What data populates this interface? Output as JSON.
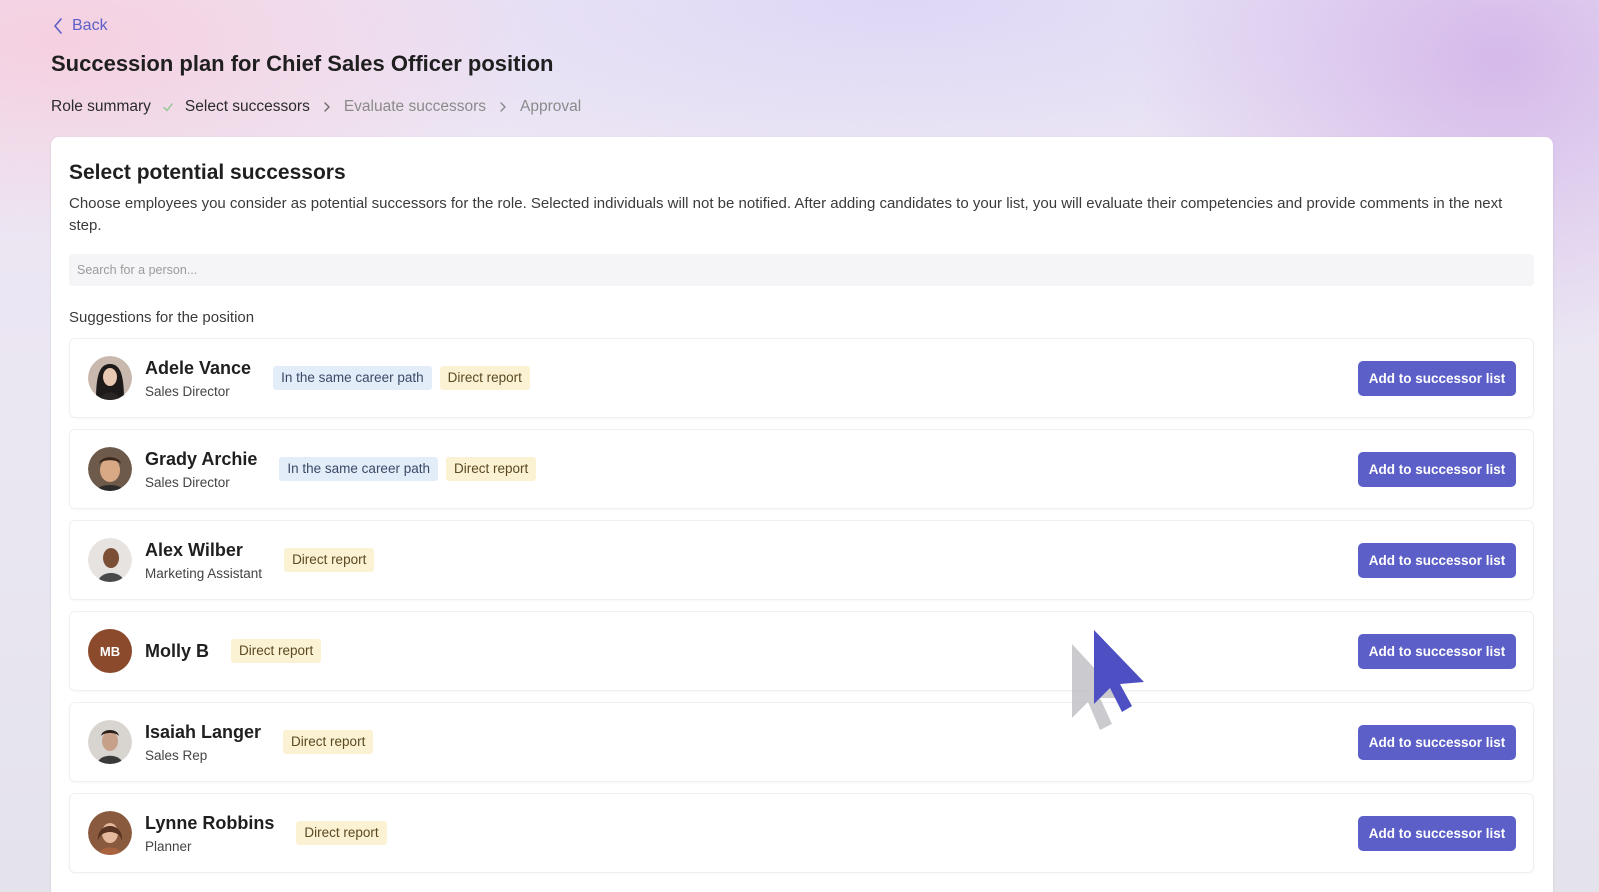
{
  "nav": {
    "back_label": "Back"
  },
  "page": {
    "title": "Succession plan for Chief Sales Officer position"
  },
  "steps": [
    {
      "label": "Role summary",
      "state": "done"
    },
    {
      "label": "Select successors",
      "state": "current"
    },
    {
      "label": "Evaluate successors",
      "state": "future"
    },
    {
      "label": "Approval",
      "state": "future"
    }
  ],
  "card": {
    "title": "Select potential successors",
    "description": "Choose employees you consider as potential successors for the role. Selected individuals will not be notified. After adding candidates to your list, you will evaluate their competencies and provide comments in the next step.",
    "search_placeholder": "Search for a person...",
    "section_label": "Suggestions for the position"
  },
  "people": [
    {
      "name": "Adele Vance",
      "role": "Sales Director",
      "tags": [
        "In the same career path",
        "Direct report"
      ],
      "button": "Add to successor list"
    },
    {
      "name": "Grady Archie",
      "role": "Sales Director",
      "tags": [
        "In the same career path",
        "Direct report"
      ],
      "button": "Add to successor list"
    },
    {
      "name": "Alex Wilber",
      "role": "Marketing Assistant",
      "tags": [
        "Direct report"
      ],
      "button": "Add to successor list"
    },
    {
      "name": "Molly B",
      "role": "",
      "initials": "MB",
      "tags": [
        "Direct report"
      ],
      "button": "Add to successor list"
    },
    {
      "name": "Isaiah Langer",
      "role": "Sales Rep",
      "tags": [
        "Direct report"
      ],
      "button": "Add to successor list"
    },
    {
      "name": "Lynne Robbins",
      "role": "Planner",
      "tags": [
        "Direct report"
      ],
      "button": "Add to successor list"
    }
  ],
  "colors": {
    "accent": "#5b5fc7",
    "tag_career_bg": "#e3ecf9",
    "tag_direct_bg": "#fbf1d3",
    "initials_avatar_bg": "#8b4a2b",
    "step_check": "#8fc88f"
  }
}
